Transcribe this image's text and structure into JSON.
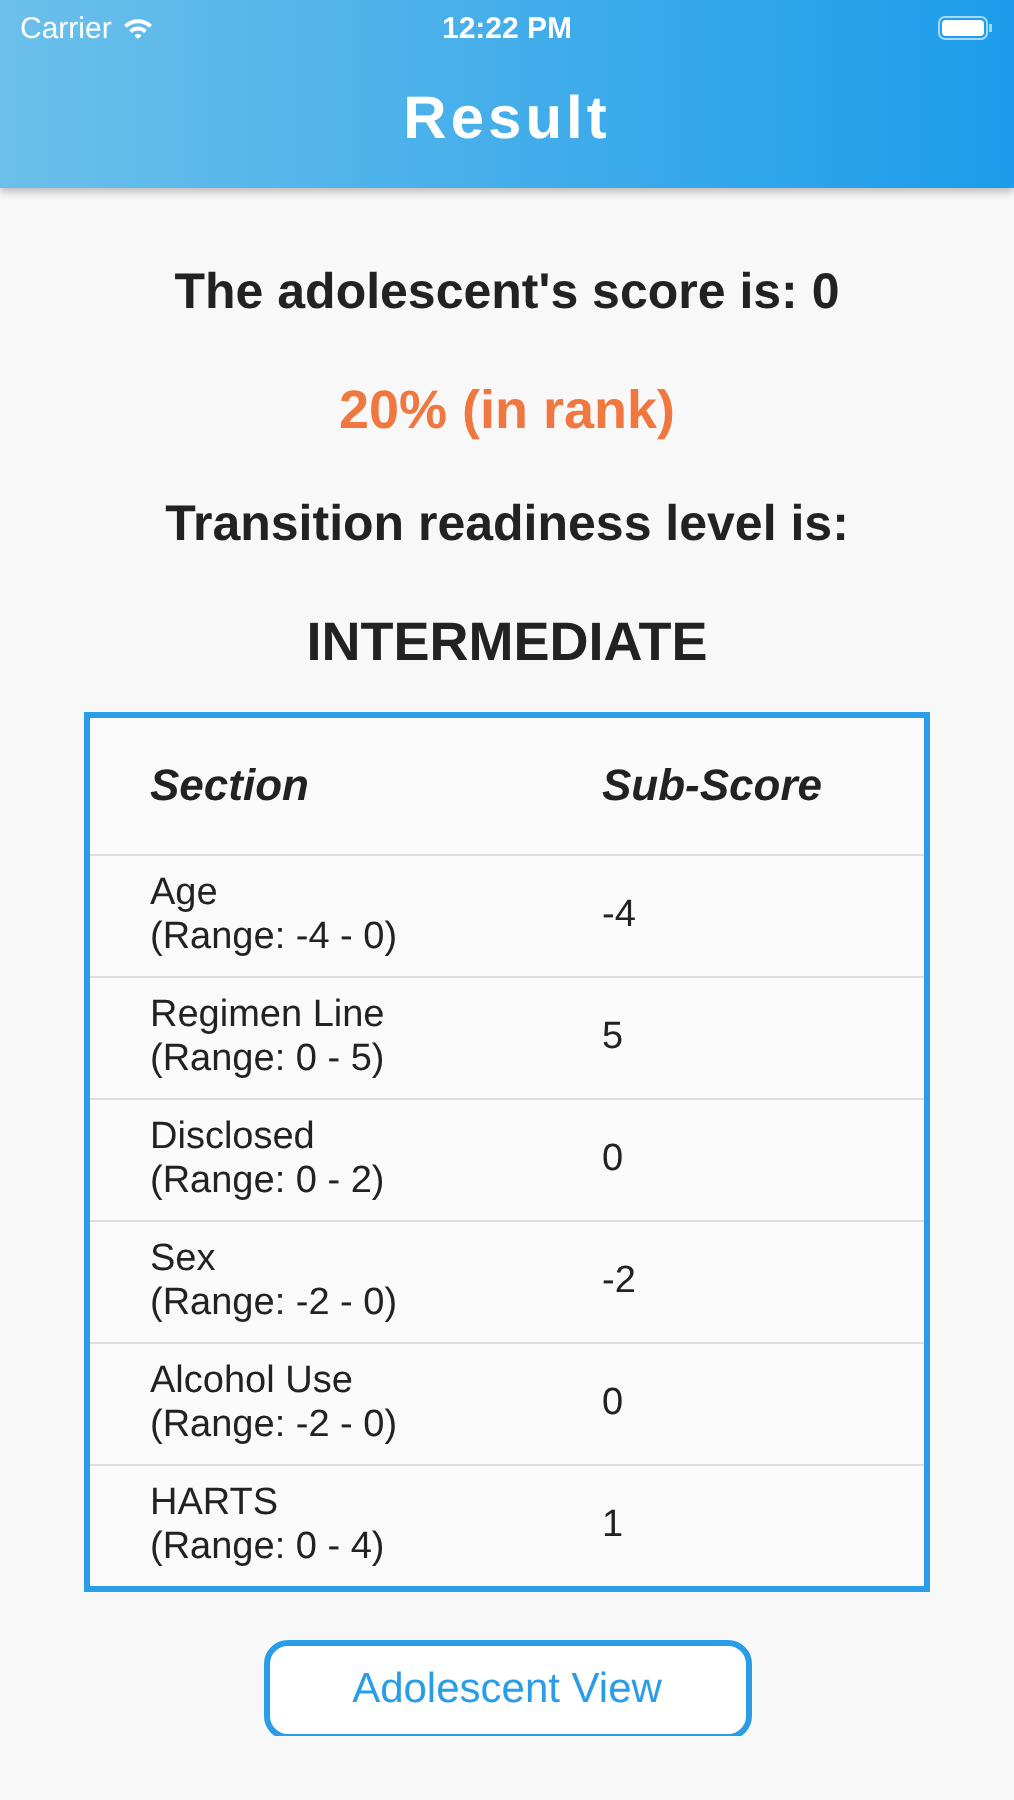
{
  "status_bar": {
    "carrier": "Carrier",
    "time": "12:22 PM"
  },
  "nav": {
    "title": "Result"
  },
  "score": "The adolescent's score is: 0",
  "rank": "20% (in rank)",
  "readiness_label": "Transition readiness level is:",
  "readiness_level": "INTERMEDIATE",
  "table": {
    "columns": [
      "Section",
      "Sub-Score"
    ],
    "rows": [
      {
        "section": "Age",
        "range": "(Range: -4 - 0)",
        "score": "-4"
      },
      {
        "section": "Regimen Line",
        "range": "(Range: 0 - 5)",
        "score": "5"
      },
      {
        "section": "Disclosed",
        "range": "(Range: 0 - 2)",
        "score": "0"
      },
      {
        "section": "Sex",
        "range": "(Range: -2 - 0)",
        "score": "-2"
      },
      {
        "section": "Alcohol Use",
        "range": "(Range: -2 - 0)",
        "score": "0"
      },
      {
        "section": "HARTS",
        "range": "(Range: 0 - 4)",
        "score": "1"
      }
    ]
  },
  "button": "Adolescent View"
}
